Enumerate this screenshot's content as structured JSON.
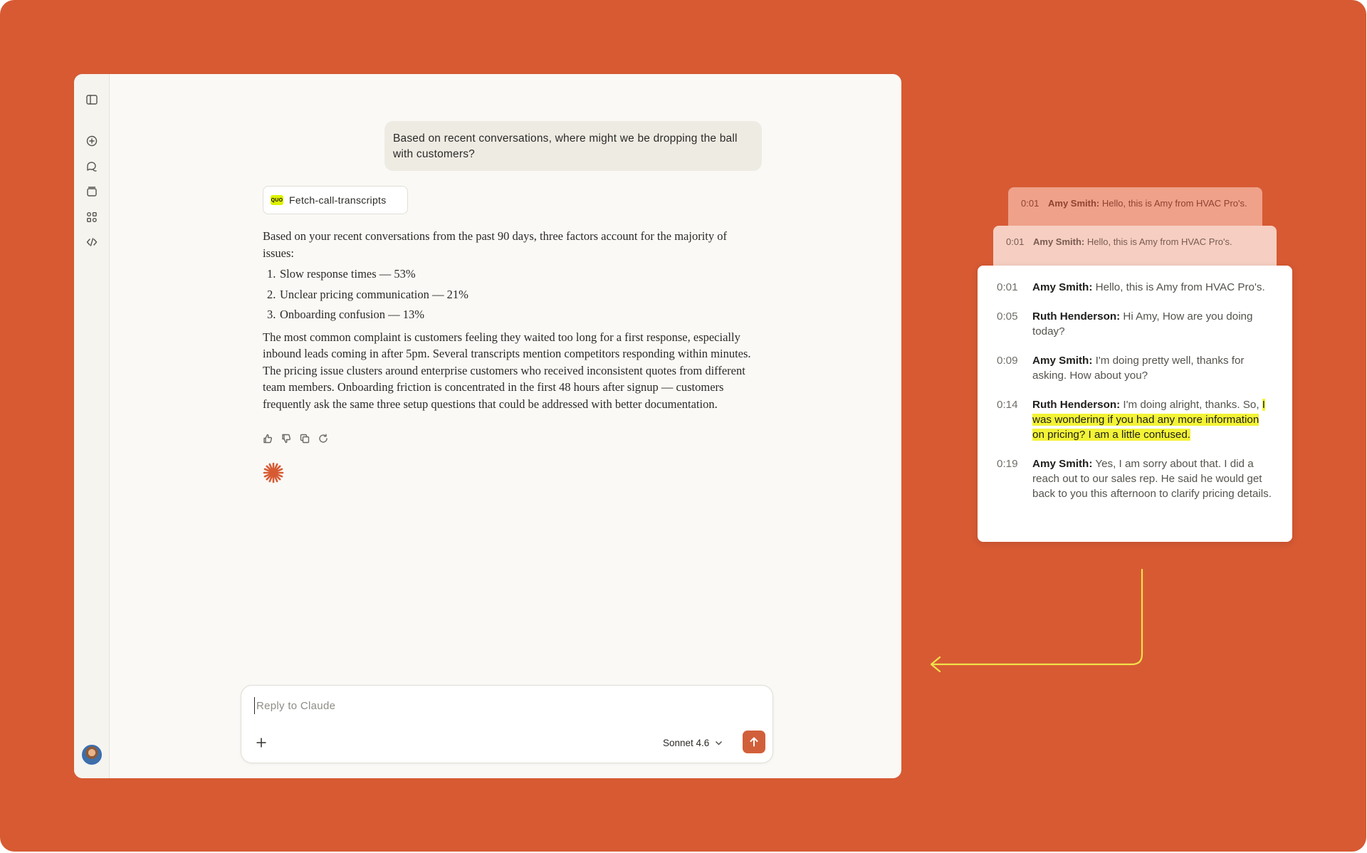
{
  "chat": {
    "user_message": "Based on recent conversations, where might we be dropping the ball with customers?",
    "tool_call": {
      "logo_text": "QUO",
      "label": "Fetch-call-transcripts"
    },
    "response": {
      "intro": "Based on your recent conversations from the past 90 days, three factors account for the majority of issues:",
      "factors": [
        {
          "num": "1.",
          "text": "Slow response times — 53%"
        },
        {
          "num": "2.",
          "text": "Unclear pricing communication — 21%"
        },
        {
          "num": "3.",
          "text": "Onboarding confusion — 13%"
        }
      ],
      "body": "The most common complaint is customers feeling they waited too long for a first response, especially inbound leads coming in after 5pm. Several transcripts mention competitors responding within minutes. The pricing issue clusters around enterprise customers who received inconsistent quotes from different team members. Onboarding friction is concentrated in the first 48 hours after signup — customers frequently ask the same three setup questions that could be addressed with better documentation."
    },
    "sidebar_icons": [
      "sidebar-toggle-icon",
      "new-chat-icon",
      "chats-icon",
      "projects-icon",
      "artifacts-icon",
      "code-icon"
    ],
    "response_action_icons": [
      "thumbs-up-icon",
      "thumbs-down-icon",
      "copy-icon",
      "retry-icon"
    ]
  },
  "composer": {
    "placeholder": "Reply to Claude",
    "model": "Sonnet 4.6"
  },
  "transcript": {
    "ghost_cards": [
      {
        "time": "0:01",
        "speaker": "Amy Smith:",
        "text": " Hello, this is Amy from HVAC Pro's."
      },
      {
        "time": "0:01",
        "speaker": "Amy Smith:",
        "text": " Hello, this is Amy from HVAC Pro's."
      }
    ],
    "turns": [
      {
        "time": "0:01",
        "speaker": "Amy Smith:",
        "text": " Hello, this is Amy from HVAC Pro's.",
        "highlight": ""
      },
      {
        "time": "0:05",
        "speaker": "Ruth Henderson:",
        "text": " Hi Amy, How are you doing today?",
        "highlight": ""
      },
      {
        "time": "0:09",
        "speaker": "Amy Smith:",
        "text": " I'm doing pretty well, thanks for asking. How about you?",
        "highlight": ""
      },
      {
        "time": "0:14",
        "speaker": "Ruth Henderson:",
        "text": " I'm doing alright, thanks. So, ",
        "highlight": "I was wondering if you had any more information on pricing? I am a little confused."
      },
      {
        "time": "0:19",
        "speaker": "Amy Smith:",
        "text": " Yes, I am sorry about that. I did a reach out to our sales rep. He said he would get back to you this afternoon to clarify pricing details.",
        "highlight": ""
      }
    ],
    "highlight_color": "#F3F336"
  },
  "colors": {
    "background": "#D75A33",
    "window": "#FAF9F6",
    "accent": "#D1603A",
    "arrow": "#F1E24A"
  }
}
